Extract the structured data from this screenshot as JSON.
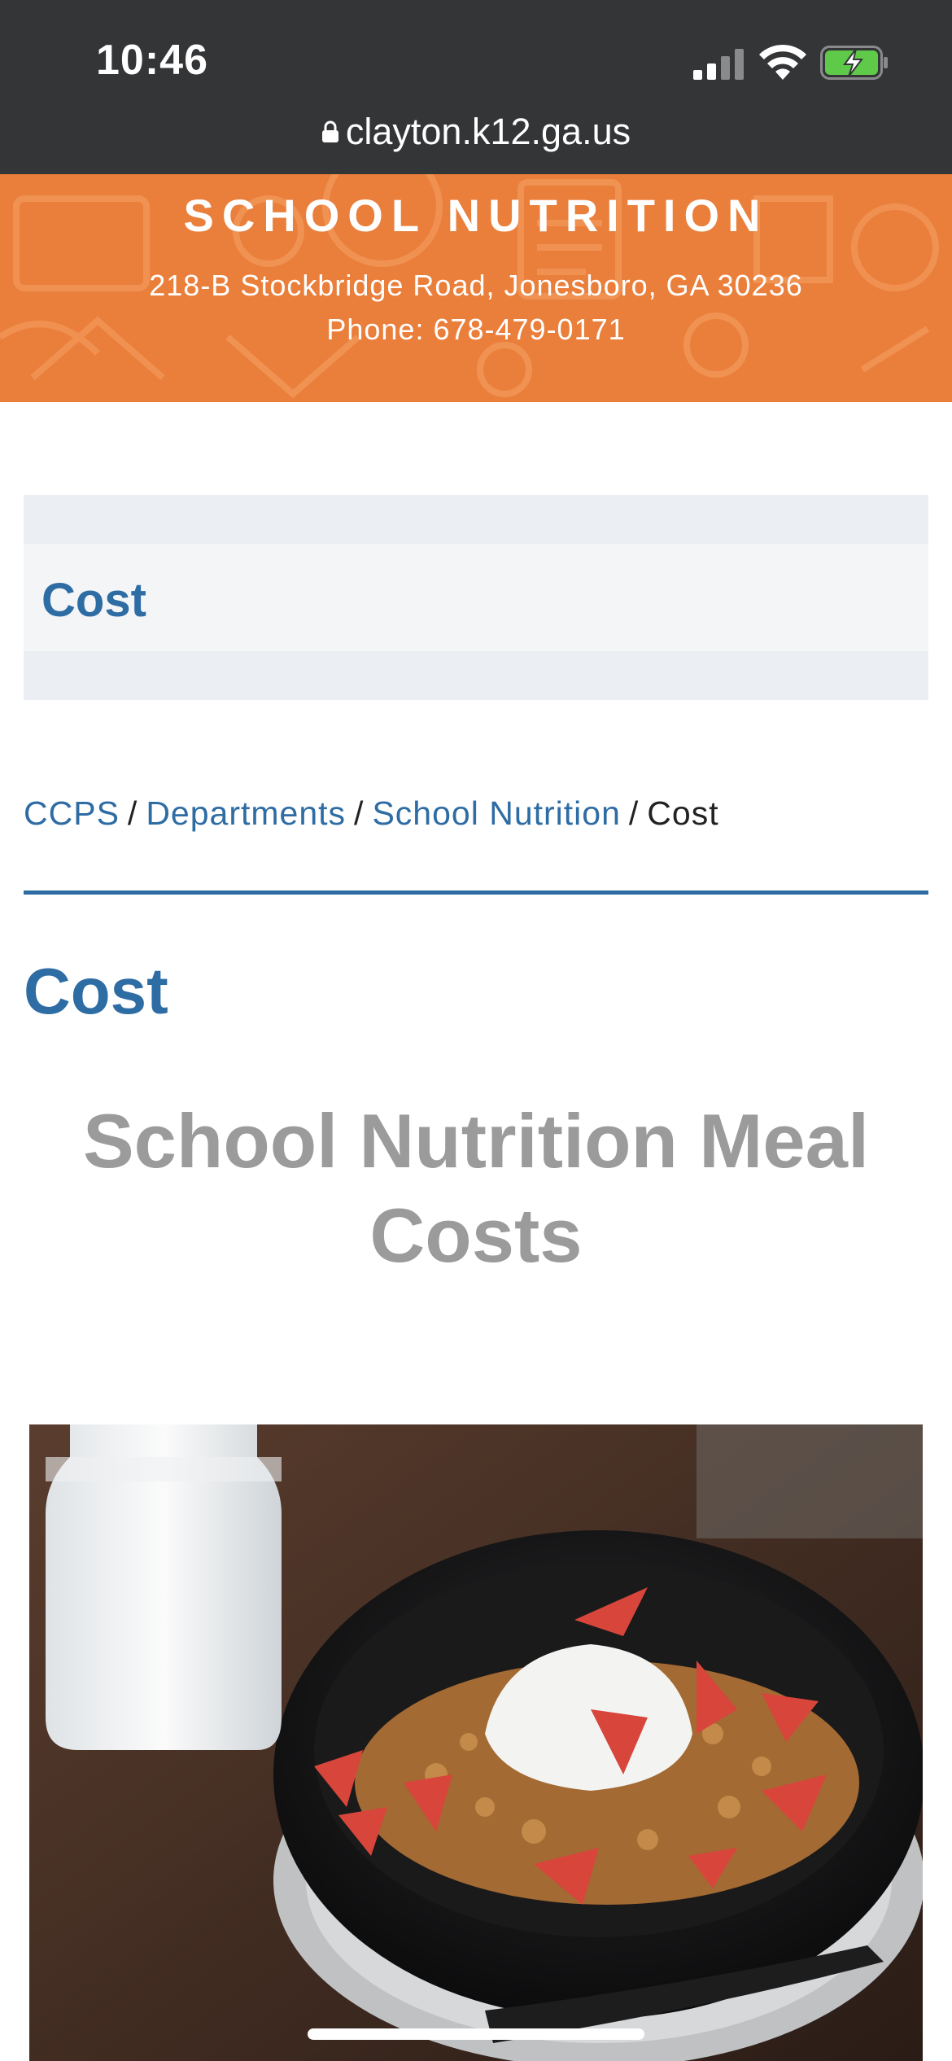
{
  "status_bar": {
    "time": "10:46",
    "url": "clayton.k12.ga.us",
    "icons": [
      "cellular-signal-icon",
      "wifi-icon",
      "battery-charging-icon"
    ]
  },
  "header": {
    "title": "SCHOOL NUTRITION",
    "address": "218-B Stockbridge Road, Jonesboro, GA 30236",
    "phone": "Phone: 678-479-0171",
    "background_color": "#ea7f3c"
  },
  "banner": {
    "title": "Cost"
  },
  "breadcrumb": {
    "items": [
      {
        "label": "CCPS",
        "link": true
      },
      {
        "label": "Departments",
        "link": true
      },
      {
        "label": "School Nutrition",
        "link": true
      },
      {
        "label": "Cost",
        "link": false
      }
    ],
    "separator": "/"
  },
  "main": {
    "heading": "Cost",
    "content_heading": "School Nutrition Meal Costs",
    "image": "granola-yogurt-strawberries-milk-photo"
  },
  "colors": {
    "accent": "#2e6ca4",
    "heading_gray": "#9b9b9b",
    "status_bar": "#343537"
  }
}
